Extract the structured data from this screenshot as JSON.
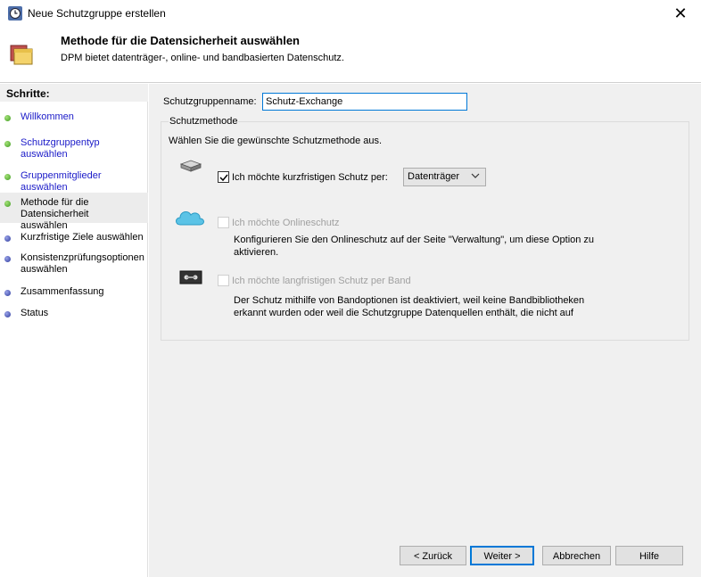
{
  "window": {
    "title": "Neue Schutzgruppe erstellen",
    "close_glyph": "✕"
  },
  "header": {
    "title": "Methode für die Datensicherheit auswählen",
    "subtitle": "DPM bietet datenträger-, online- und bandbasierten Datenschutz."
  },
  "sidebar": {
    "heading": "Schritte:",
    "steps": [
      {
        "label": "Willkommen",
        "state": "done"
      },
      {
        "label": "Schutzgruppentyp auswählen",
        "state": "done"
      },
      {
        "label": "Gruppenmitglieder auswählen",
        "state": "done"
      },
      {
        "label": "Methode für die Datensicherheit auswählen",
        "state": "current"
      },
      {
        "label": "Kurzfristige Ziele auswählen",
        "state": "pending"
      },
      {
        "label": "Konsistenzprüfungsoptionen auswählen",
        "state": "pending"
      },
      {
        "label": "Zusammenfassung",
        "state": "pending"
      },
      {
        "label": "Status",
        "state": "pending"
      }
    ]
  },
  "form": {
    "name_label": "Schutzgruppenname:",
    "name_value": "Schutz-Exchange",
    "group_title": "Schutzmethode",
    "intro": "Wählen Sie die gewünschte Schutzmethode aus.",
    "short_term": {
      "label": "Ich möchte kurzfristigen Schutz per:",
      "checked": true,
      "select_value": "Datenträger",
      "icon": "disk-icon"
    },
    "online": {
      "label": "Ich möchte Onlineschutz",
      "checked": false,
      "enabled": false,
      "description": "Konfigurieren Sie den Onlineschutz auf der Seite \"Verwaltung\", um diese Option zu aktivieren.",
      "icon": "cloud-icon"
    },
    "tape": {
      "label": "Ich möchte langfristigen Schutz per Band",
      "checked": false,
      "enabled": false,
      "description": "Der Schutz mithilfe von Bandoptionen ist deaktiviert, weil keine Bandbibliotheken erkannt wurden oder weil die Schutzgruppe Datenquellen enthält, die nicht auf",
      "icon": "tape-icon"
    }
  },
  "buttons": {
    "back": "< Zurück",
    "next": "Weiter >",
    "cancel": "Abbrechen",
    "help": "Hilfe"
  },
  "colors": {
    "link": "#1a1ac8",
    "accent": "#0078d7",
    "step_done": "#3c9a1e",
    "step_pending": "#2c3a9c"
  }
}
